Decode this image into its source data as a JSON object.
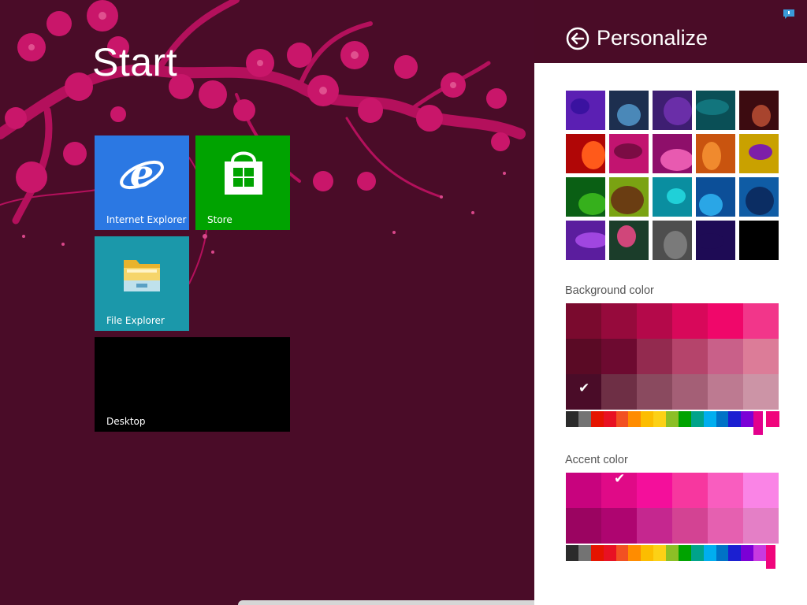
{
  "start": {
    "title": "Start",
    "tiles": [
      {
        "label": "Internet Explorer",
        "color": "#2b78e3",
        "icon": "internet-explorer-icon"
      },
      {
        "label": "Store",
        "color": "#00a300",
        "icon": "store-icon"
      },
      {
        "label": "File Explorer",
        "color": "#1b98aa",
        "icon": "file-explorer-icon"
      },
      {
        "label": "Desktop",
        "color": "#000000",
        "icon": "desktop-icon"
      }
    ]
  },
  "panel": {
    "title": "Personalize",
    "back_icon": "back-arrow-icon",
    "notification_icon": "notification-icon",
    "patterns": [
      {
        "bg": "#5b1fb3",
        "fg": "#3a12a0"
      },
      {
        "bg": "#1d2f4f",
        "fg": "#4a88b8"
      },
      {
        "bg": "#3e1e72",
        "fg": "#6a2ea8"
      },
      {
        "bg": "#0a4f56",
        "fg": "#12757d"
      },
      {
        "bg": "#3c0b10",
        "fg": "#a8442e"
      },
      {
        "bg": "#b00606",
        "fg": "#ff5a1a"
      },
      {
        "bg": "#c21470",
        "fg": "#7b0c44"
      },
      {
        "bg": "#8e0f6a",
        "fg": "#e85ab0"
      },
      {
        "bg": "#c9540f",
        "fg": "#f08a2e"
      },
      {
        "bg": "#c9a100",
        "fg": "#7d1fa8"
      },
      {
        "bg": "#0a5f14",
        "fg": "#36b01c"
      },
      {
        "bg": "#7aa312",
        "fg": "#6a3d12"
      },
      {
        "bg": "#0a8ea0",
        "fg": "#20d0d8"
      },
      {
        "bg": "#0c4f98",
        "fg": "#2aa6e6"
      },
      {
        "bg": "#0f5ca5",
        "fg": "#0b2d63"
      },
      {
        "bg": "#5b1d9e",
        "fg": "#a046e0"
      },
      {
        "bg": "#1b3d2a",
        "fg": "#d0467a"
      },
      {
        "bg": "#4e4e4e",
        "fg": "#7a7a7a"
      },
      {
        "bg": "#1e0b55",
        "fg": "#1e0b55"
      },
      {
        "bg": "#000000",
        "fg": "#000000"
      }
    ],
    "background_color": {
      "label": "Background color",
      "selected_index": 12,
      "swatches": [
        "#7a0a2e",
        "#960a3c",
        "#b4094a",
        "#d8085a",
        "#f0076a",
        "#f2368a",
        "#5a0a25",
        "#6d0a30",
        "#932a4f",
        "#b5446b",
        "#c96089",
        "#dc7c98",
        "#4a0c28",
        "#6e2f45",
        "#8a4a5f",
        "#a45f76",
        "#bd7a91",
        "#cc94a6"
      ],
      "hues": [
        "#2b2b2b",
        "#737373",
        "#e51400",
        "#e81123",
        "#f25022",
        "#ff8c00",
        "#fcbd00",
        "#fcd116",
        "#8cbf26",
        "#00a300",
        "#00a38a",
        "#00aeef",
        "#0072c6",
        "#1b1fd1",
        "#7b00d6",
        "#e3008c",
        "#f0057c"
      ]
    },
    "accent_color": {
      "label": "Accent color",
      "selected_index": 1,
      "swatches": [
        "#c8037e",
        "#e00a87",
        "#f40f9b",
        "#f7379f",
        "#f95dbf",
        "#fa84e6",
        "#9b0461",
        "#ae0570",
        "#c5278f",
        "#d34393",
        "#e560b0",
        "#e47fc6"
      ],
      "hues": [
        "#2b2b2b",
        "#737373",
        "#e51400",
        "#e81123",
        "#f25022",
        "#ff8c00",
        "#fcbd00",
        "#fcd116",
        "#8cbf26",
        "#00a300",
        "#00a38a",
        "#00aeef",
        "#0072c6",
        "#1b1fd1",
        "#7b00d6",
        "#c83ae0",
        "#f0057c"
      ]
    }
  }
}
